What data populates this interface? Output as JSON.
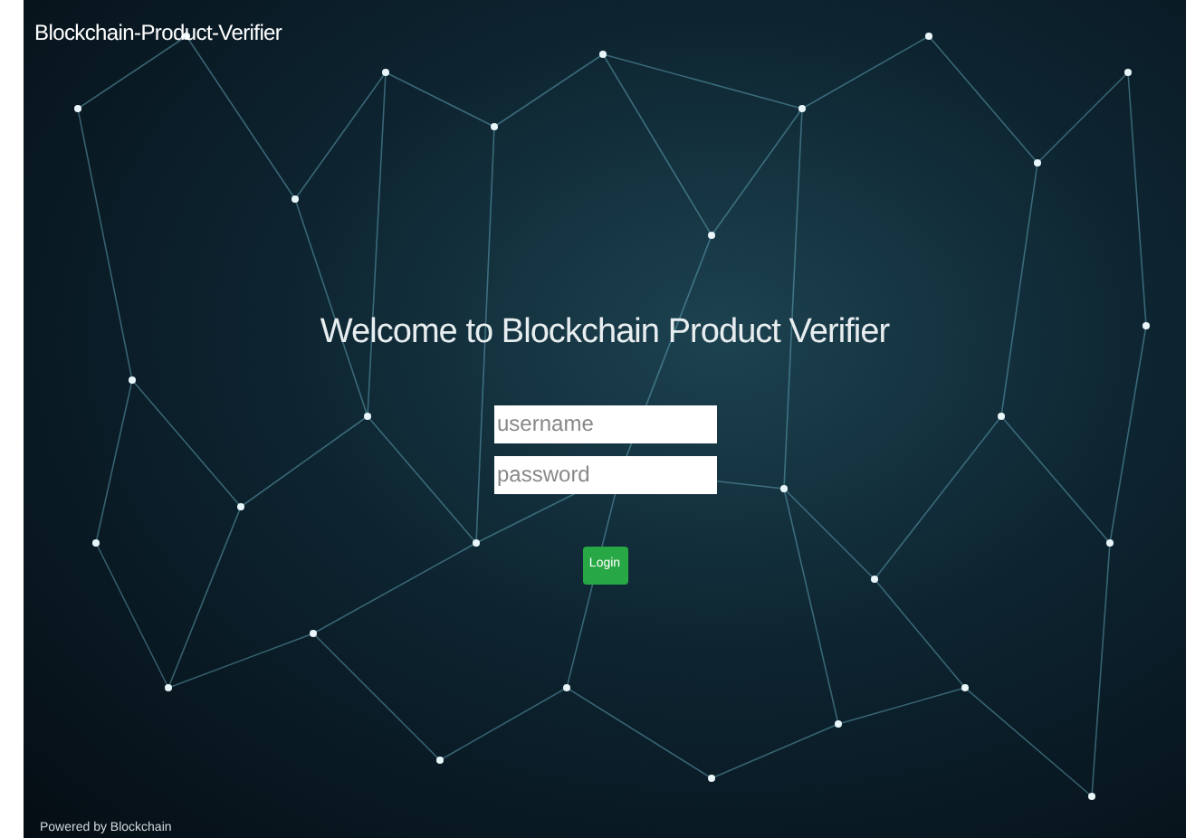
{
  "navbar": {
    "brand": "Blockchain-Product-Verifier"
  },
  "login": {
    "heading": "Welcome to Blockchain Product Verifier",
    "username": {
      "placeholder": "username"
    },
    "password": {
      "placeholder": "password"
    },
    "button": "Login"
  },
  "footer": {
    "text": "Powered by Blockchain"
  }
}
